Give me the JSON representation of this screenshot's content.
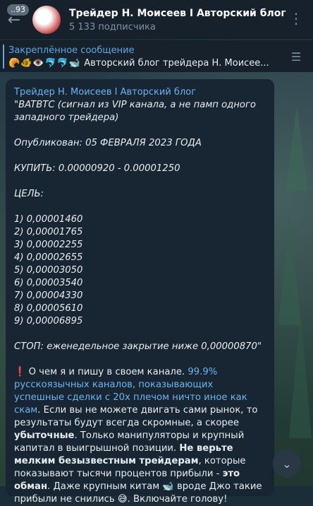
{
  "header": {
    "back_badge": "93",
    "title": "Трейдер Н. Моисеев I Авторский блог",
    "subscribers": "5 133 подписчика"
  },
  "pinned": {
    "title": "Закреплённое сообщение",
    "emojis": "🥐🐠👁️🐬🐬🐋",
    "preview": "Авторский блог трейдера Н. Моисее..."
  },
  "message": {
    "author": "Трейдер Н. Моисеев I Авторский блог",
    "line_pair": "\"BATBTC (сигнал из VIP канала, а не памп одного западного трейдера)",
    "published": "Опубликован: 05 ФЕВРАЛЯ 2023 ГОДА",
    "buy": "КУПИТЬ: 0.00000920 - 0.00001250",
    "target_label": "ЦЕЛЬ:",
    "targets": [
      "1) 0,00001460",
      "2) 0,00001765",
      "3) 0,00002255",
      "4) 0,00002655",
      "5) 0,00003050",
      "6) 0,00003540",
      "7) 0,00004330",
      "8) 0,00005610",
      "9) 0,00006895"
    ],
    "stop": "СТОП: еженедельное закрытие ниже 0,00000870\"",
    "p1_mark": "❗",
    "p1_a": " О чем я и пишу в своем канале. ",
    "p1_link": "99.9% русскоязычных каналов, показывающих успешные сделки с 20х плечом ничто иное как скам",
    "p1_b": ". Если вы не можете двигать сами рынок, то результаты будут всегда скромные, а скорее ",
    "p1_bold1": "убыточные",
    "p1_c": ".  Только манипуляторы и крупный капитал в выигрышной позиции. ",
    "p1_bold2": "Не верьте мелким безызвестным трейдерам",
    "p1_d": ", которые показывают тысячи процентов прибыли - ",
    "p1_bold3": "это обман",
    "p1_e": ". Даже крупным китам ",
    "p1_whale": "🐋",
    "p1_f": " вроде Джо такие прибыли не снились ",
    "p1_smile": "😅",
    "p1_g": ". Включайте голову!"
  },
  "icons": {
    "back": "arrow-left-icon",
    "menu": "more-vertical-icon",
    "pin": "pin-list-icon",
    "scroll": "chevron-down-icon"
  }
}
